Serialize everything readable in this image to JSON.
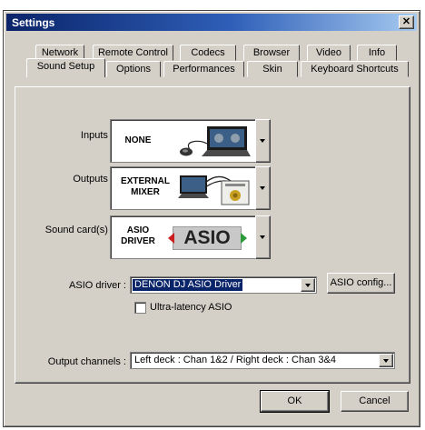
{
  "window": {
    "title": "Settings",
    "close_label": "✕"
  },
  "tabs_top": [
    {
      "label": "Network"
    },
    {
      "label": "Remote Control"
    },
    {
      "label": "Codecs"
    },
    {
      "label": "Browser"
    },
    {
      "label": "Video"
    },
    {
      "label": "Info"
    }
  ],
  "tabs_bottom": [
    {
      "label": "Sound Setup",
      "active": true
    },
    {
      "label": "Options"
    },
    {
      "label": "Performances"
    },
    {
      "label": "Skin"
    },
    {
      "label": "Keyboard Shortcuts"
    }
  ],
  "sound_setup": {
    "inputs": {
      "label": "Inputs :",
      "value": "NONE",
      "icon": "laptop-mouse-illustration"
    },
    "outputs": {
      "label": "Outputs :",
      "value_line1": "EXTERNAL",
      "value_line2": "MIXER",
      "icon": "laptop-mixer-illustration"
    },
    "sound_card": {
      "label": "Sound card(s) :",
      "value_line1": "ASIO",
      "value_line2": "DRIVER",
      "logo_text": "ASIO"
    },
    "asio_driver": {
      "label": "ASIO driver :",
      "value": "DENON DJ ASIO Driver",
      "config_button": "ASIO config..."
    },
    "ultra_latency": {
      "label": "Ultra-latency ASIO",
      "checked": false
    },
    "output_channels": {
      "label": "Output channels :",
      "value": "Left deck : Chan 1&2 / Right deck : Chan 3&4"
    }
  },
  "buttons": {
    "ok": "OK",
    "cancel": "Cancel"
  },
  "colors": {
    "title_bar": "#0a246a",
    "selection": "#0a246a",
    "dialog_face": "#d4d0c8",
    "asio_red": "#cc1f1f",
    "asio_green": "#2a9a3a"
  }
}
